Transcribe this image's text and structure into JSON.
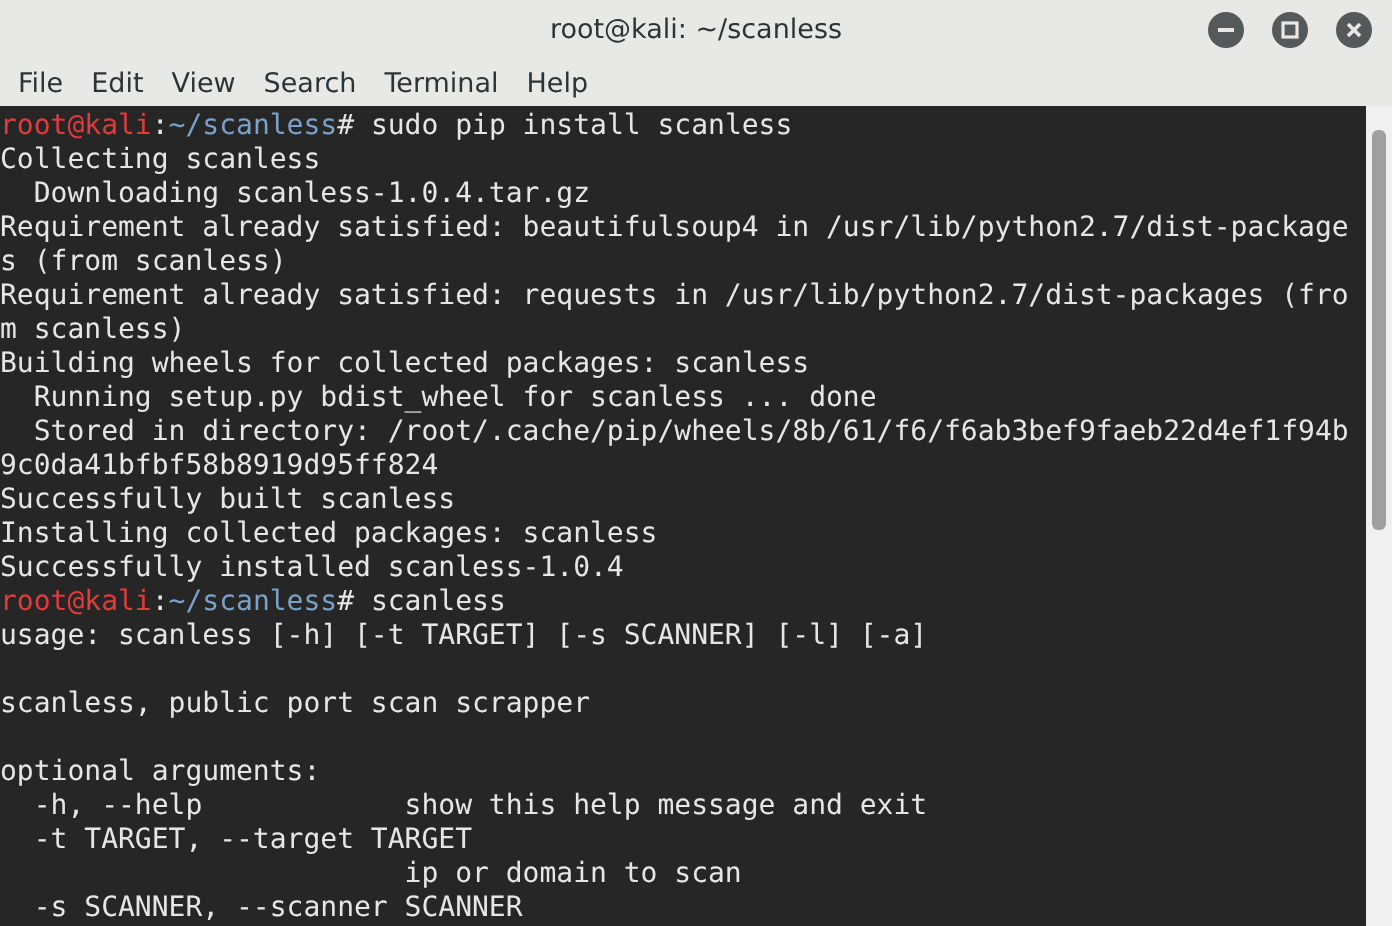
{
  "window": {
    "title": "root@kali: ~/scanless"
  },
  "menu": [
    "File",
    "Edit",
    "View",
    "Search",
    "Terminal",
    "Help"
  ],
  "terminal": {
    "lines": [
      {
        "kind": "prompt",
        "user": "root@kali",
        "separator": ":",
        "path": "~/scanless",
        "command": "# sudo pip install scanless"
      },
      {
        "kind": "output",
        "text": "Collecting scanless"
      },
      {
        "kind": "output",
        "text": "  Downloading scanless-1.0.4.tar.gz"
      },
      {
        "kind": "output",
        "text": "Requirement already satisfied: beautifulsoup4 in /usr/lib/python2.7/dist-package"
      },
      {
        "kind": "output",
        "text": "s (from scanless)"
      },
      {
        "kind": "output",
        "text": "Requirement already satisfied: requests in /usr/lib/python2.7/dist-packages (fro"
      },
      {
        "kind": "output",
        "text": "m scanless)"
      },
      {
        "kind": "output",
        "text": "Building wheels for collected packages: scanless"
      },
      {
        "kind": "output",
        "text": "  Running setup.py bdist_wheel for scanless ... done"
      },
      {
        "kind": "output",
        "text": "  Stored in directory: /root/.cache/pip/wheels/8b/61/f6/f6ab3bef9faeb22d4ef1f94b"
      },
      {
        "kind": "output",
        "text": "9c0da41bfbf58b8919d95ff824"
      },
      {
        "kind": "output",
        "text": "Successfully built scanless"
      },
      {
        "kind": "output",
        "text": "Installing collected packages: scanless"
      },
      {
        "kind": "output",
        "text": "Successfully installed scanless-1.0.4"
      },
      {
        "kind": "prompt",
        "user": "root@kali",
        "separator": ":",
        "path": "~/scanless",
        "command": "# scanless"
      },
      {
        "kind": "output",
        "text": "usage: scanless [-h] [-t TARGET] [-s SCANNER] [-l] [-a]"
      },
      {
        "kind": "blank"
      },
      {
        "kind": "output",
        "text": "scanless, public port scan scrapper"
      },
      {
        "kind": "blank"
      },
      {
        "kind": "output",
        "text": "optional arguments:"
      },
      {
        "kind": "output",
        "text": "  -h, --help            show this help message and exit"
      },
      {
        "kind": "output",
        "text": "  -t TARGET, --target TARGET"
      },
      {
        "kind": "output",
        "text": "                        ip or domain to scan"
      },
      {
        "kind": "output",
        "text": "  -s SCANNER, --scanner SCANNER"
      }
    ]
  }
}
